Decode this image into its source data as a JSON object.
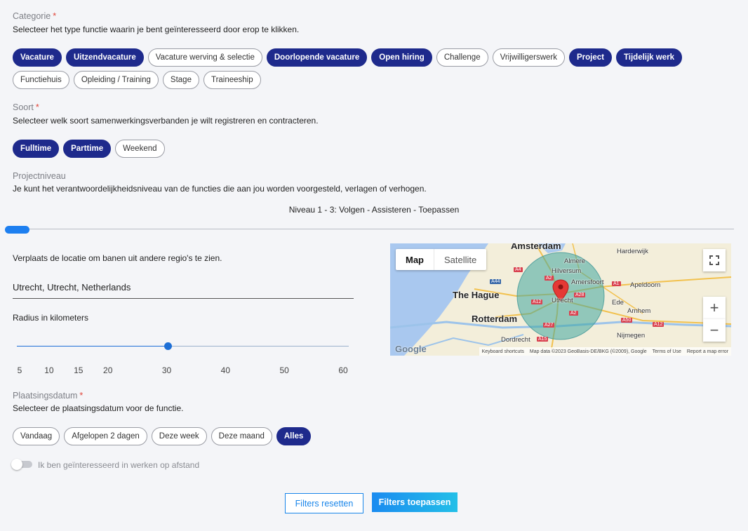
{
  "categorie": {
    "label": "Categorie",
    "required": "*",
    "description": "Selecteer het type functie waarin je bent geïnteresseerd door erop te klikken.",
    "chips": [
      {
        "label": "Vacature",
        "selected": true
      },
      {
        "label": "Uitzendvacature",
        "selected": true
      },
      {
        "label": "Vacature werving & selectie",
        "selected": false
      },
      {
        "label": "Doorlopende vacature",
        "selected": true
      },
      {
        "label": "Open hiring",
        "selected": true
      },
      {
        "label": "Challenge",
        "selected": false
      },
      {
        "label": "Vrijwilligerswerk",
        "selected": false
      },
      {
        "label": "Project",
        "selected": true
      },
      {
        "label": "Tijdelijk werk",
        "selected": true
      },
      {
        "label": "Functiehuis",
        "selected": false
      },
      {
        "label": "Opleiding / Training",
        "selected": false
      },
      {
        "label": "Stage",
        "selected": false
      },
      {
        "label": "Traineeship",
        "selected": false
      }
    ]
  },
  "soort": {
    "label": "Soort",
    "required": "*",
    "description": "Selecteer welk soort samenwerkingsverbanden je wilt registreren en contracteren.",
    "chips": [
      {
        "label": "Fulltime",
        "selected": true
      },
      {
        "label": "Parttime",
        "selected": true
      },
      {
        "label": "Weekend",
        "selected": false
      }
    ]
  },
  "projectniveau": {
    "label": "Projectniveau",
    "description": "Je kunt het verantwoordelijkheidsniveau van de functies die aan jou worden voorgesteld, verlagen of verhogen.",
    "range_caption": "Niveau 1 - 3: Volgen - Assisteren - Toepassen"
  },
  "locatie": {
    "description": "Verplaats de locatie om banen uit andere regio's te zien.",
    "value": "Utrecht, Utrecht, Netherlands",
    "radius_label": "Radius in kilometers",
    "radius_value": 30,
    "radius_min": 5,
    "radius_max": 60,
    "ticks": [
      "5",
      "10",
      "15",
      "20",
      "30",
      "40",
      "50",
      "60"
    ]
  },
  "map": {
    "tab_map": "Map",
    "tab_satellite": "Satellite",
    "zoom_in": "+",
    "zoom_out": "−",
    "logo": "Google",
    "labels": {
      "amsterdam": "Amsterdam",
      "the_hague": "The Hague",
      "rotterdam": "Rotterdam",
      "utrecht": "Utrecht",
      "amersfoort": "Amersfoort",
      "apeldoorn": "Apeldoorn",
      "arnhem": "Arnhem",
      "nijmegen": "Nijmegen",
      "dordrecht": "Dordrecht",
      "hilversum": "Hilversum",
      "almere": "Almere",
      "harderwijk": "Harderwijk",
      "ede": "Ede"
    },
    "attribution": {
      "shortcuts": "Keyboard shortcuts",
      "data": "Map data ©2023 GeoBasis-DE/BKG (©2009), Google",
      "terms": "Terms of Use",
      "report": "Report a map error"
    }
  },
  "plaatsingsdatum": {
    "label": "Plaatsingsdatum",
    "required": "*",
    "description": "Selecteer de plaatsingsdatum voor de functie.",
    "chips": [
      {
        "label": "Vandaag",
        "selected": false
      },
      {
        "label": "Afgelopen 2 dagen",
        "selected": false
      },
      {
        "label": "Deze week",
        "selected": false
      },
      {
        "label": "Deze maand",
        "selected": false
      },
      {
        "label": "Alles",
        "selected": true
      }
    ]
  },
  "remote": {
    "label": "Ik ben geïnteresseerd in werken op afstand",
    "enabled": false
  },
  "buttons": {
    "reset": "Filters resetten",
    "apply": "Filters toepassen"
  }
}
